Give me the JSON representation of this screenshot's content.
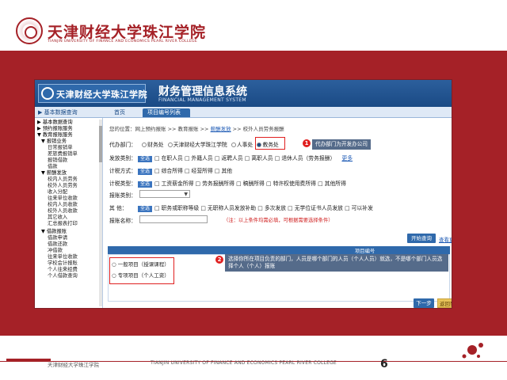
{
  "slide": {
    "brand_cn": "天津财经大学珠江学院",
    "brand_en": "TIANJIN UNIVERSITY OF FINANCE AND ECONOMICS PEARL RIVER COLLEGE",
    "page_number": "6",
    "footer_cn": "天津财经大学珠江学院",
    "footer_en": "TIANJIN UNIVERSITY OF FINANCE AND ECONOMICS PEARL RIVER COLLEGE"
  },
  "app": {
    "logo_text": "天津财经大学珠江学院",
    "title": "财务管理信息系统",
    "subtitle": "FINANCIAL MANAGEMENT SYSTEM",
    "side_tab": "▶ 基本数据查询",
    "nav_home": "首页",
    "nav_active": "项目编号列表"
  },
  "sidebar": {
    "items": [
      {
        "label": "▶ 基本数据查询",
        "group": true
      },
      {
        "label": "▶ 预约报账服务",
        "group": true
      },
      {
        "label": "▼ 教育报账服务",
        "group": true
      },
      {
        "label": "▼ 报销业务",
        "group": true
      },
      {
        "label": "  日常报销单",
        "group": false
      },
      {
        "label": "  差旅费报销单",
        "group": false
      },
      {
        "label": "  报销借款",
        "group": false
      },
      {
        "label": "  借款",
        "group": false
      },
      {
        "label": "▼ 薪酬发放",
        "group": true
      },
      {
        "label": "  校内人员劳务",
        "group": false
      },
      {
        "label": "  校外人员劳务",
        "group": false
      },
      {
        "label": "  收入分配",
        "group": false
      },
      {
        "label": "  往来单位收款",
        "group": false
      },
      {
        "label": "  校内人员收款",
        "group": false
      },
      {
        "label": "  校外人员收款",
        "group": false
      },
      {
        "label": "  其它收入",
        "group": false
      },
      {
        "label": "  汇总报表打印",
        "group": false
      },
      {
        "label": "▼ 借款报账",
        "group": true
      },
      {
        "label": "  借款申请",
        "group": false
      },
      {
        "label": "  借款还款",
        "group": false
      },
      {
        "label": "  冲借款",
        "group": false
      },
      {
        "label": "  往来单位收款",
        "group": false
      },
      {
        "label": "  学校会计报账",
        "group": false
      },
      {
        "label": "  个人往来经费",
        "group": false
      },
      {
        "label": "  个人借款查询",
        "group": false
      }
    ]
  },
  "main": {
    "breadcrumb_prefix": "您的位置：",
    "breadcrumb_text": "网上预约报账 >> 教育报账 >> ",
    "breadcrumb_link": "薪酬发放",
    "breadcrumb_tail": " >> 校外人员劳务报酬",
    "rows": {
      "dept": {
        "label": "代办部门：",
        "options": [
          "财务处",
          "天津财经大学珠江学院",
          "人事处"
        ],
        "selected": "教务处"
      },
      "payee": {
        "label": "发放类别：",
        "chip": "全选",
        "text": "□ 在职人员 □ 外籍人员 □ 返聘人员 □ 离职人员 □ 退休人员（劳务报酬）",
        "more": "更多"
      },
      "tax": {
        "label": "计税方式：",
        "chip": "全选",
        "text": "□ 综合所得 □ 经营所得 □ 其他"
      },
      "type": {
        "label": "计税类型：",
        "chip": "全选",
        "text": "□ 工资薪金所得 □ 劳务报酬所得 □ 稿酬所得 □ 特许权使用费所得 □ 其他所得"
      },
      "status": {
        "label": "报账类别：",
        "select_value": ""
      },
      "detail": {
        "label": "其  他：",
        "chip": "全选",
        "text": "□ 职务或职称等级 □ 无职称人员发放补助 □ 多次发放 □ 无学位证书人员发放 □ 可以补发"
      },
      "name": {
        "label": "报账名称：",
        "hint": "（注：以上条件均需必填，可根据需要选择条件）"
      }
    },
    "callout1": "代办部门为开发办公司",
    "callout2": "选择你所在项目负责的部门，人员是哪个部门的人员（个人人员）就选，不是哪个部门人员选择个人（个人）报账",
    "btn_query": "开始查询",
    "link_more": "查看更多数据请点击此处",
    "table_header": "项目编号",
    "projects": [
      "○ 一般项目（授课课程）",
      "○ 专项项目（个人工资）"
    ],
    "btn_next": "下一步",
    "btn_cancel": "返回列表"
  },
  "colors": {
    "brand_red": "#a52127",
    "app_blue": "#2f69ab",
    "highlight_red": "#e02020"
  }
}
